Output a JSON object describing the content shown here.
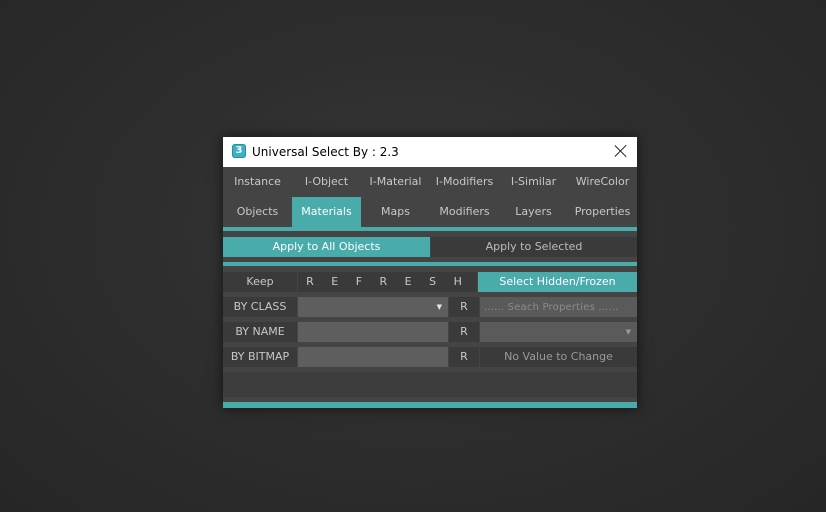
{
  "window": {
    "title": "Universal Select By : 2.3",
    "app_icon": "3"
  },
  "tabs_row1": [
    "Instance",
    "I-Object",
    "I-Material",
    "I-Modifiers",
    "I-Similar",
    "WireColor"
  ],
  "tabs_row2": [
    "Objects",
    "Materials",
    "Maps",
    "Modifiers",
    "Layers",
    "Properties"
  ],
  "active_tab": "Materials",
  "apply": {
    "all": "Apply to All Objects",
    "selected": "Apply to Selected"
  },
  "controls": {
    "keep": "Keep",
    "refresh": "R E F R E S H",
    "select_hidden": "Select Hidden/Frozen"
  },
  "rows": {
    "by_class": {
      "label": "BY CLASS",
      "r": "R",
      "search_placeholder": "...... Seach Properties ......"
    },
    "by_name": {
      "label": "BY NAME",
      "r": "R"
    },
    "by_bitmap": {
      "label": "BY BITMAP",
      "r": "R",
      "right_text": "No Value to Change"
    }
  },
  "colors": {
    "accent": "#4aabab",
    "panel": "#444444",
    "control": "#3a3a3a",
    "field": "#5e5e5e"
  }
}
